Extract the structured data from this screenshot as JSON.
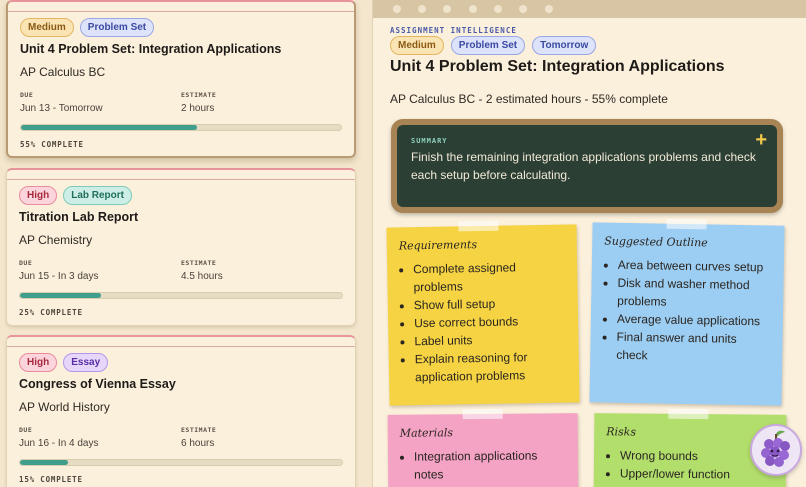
{
  "assignments": [
    {
      "priority": "Medium",
      "type": "Problem Set",
      "title": "Unit 4 Problem Set: Integration Applications",
      "course": "AP Calculus BC",
      "due_label": "DUE",
      "due": "Jun 13 - Tomorrow",
      "estimate_label": "ESTIMATE",
      "estimate": "2 hours",
      "progress": 55,
      "progress_text": "55% COMPLETE"
    },
    {
      "priority": "High",
      "type": "Lab Report",
      "title": "Titration Lab Report",
      "course": "AP Chemistry",
      "due_label": "DUE",
      "due": "Jun 15 - In 3 days",
      "estimate_label": "ESTIMATE",
      "estimate": "4.5 hours",
      "progress": 25,
      "progress_text": "25% COMPLETE"
    },
    {
      "priority": "High",
      "type": "Essay",
      "title": "Congress of Vienna Essay",
      "course": "AP World History",
      "due_label": "DUE",
      "due": "Jun 16 - In 4 days",
      "estimate_label": "ESTIMATE",
      "estimate": "6 hours",
      "progress": 15,
      "progress_text": "15% COMPLETE"
    }
  ],
  "detail": {
    "eyebrow": "ASSIGNMENT INTELLIGENCE",
    "badges": [
      "Medium",
      "Problem Set",
      "Tomorrow"
    ],
    "title": "Unit 4 Problem Set: Integration Applications",
    "subtitle": "AP Calculus BC - 2 estimated hours - 55% complete",
    "summary_label": "SUMMARY",
    "summary": "Finish the remaining integration applications problems and check each setup before calculating.",
    "summary_action": "+",
    "requirements": {
      "title": "Requirements",
      "items": [
        "Complete assigned problems",
        "Show full setup",
        "Use correct bounds",
        "Label units",
        "Explain reasoning for application problems"
      ]
    },
    "outline": {
      "title": "Suggested Outline",
      "items": [
        "Area between curves setup",
        "Disk and washer method problems",
        "Average value applications",
        "Final answer and units check"
      ]
    },
    "materials": {
      "title": "Materials",
      "items": [
        "Integration applications notes"
      ]
    },
    "risks": {
      "title": "Risks",
      "items": [
        "Wrong bounds",
        "Upper/lower function"
      ]
    }
  },
  "colors": {
    "accent_teal": "#3f9e8c",
    "summary_bg": "#2c3f34",
    "note_yellow": "#f5d343",
    "note_blue": "#9ccdf2",
    "note_pink": "#f4a3c5",
    "note_green": "#b2de6c"
  },
  "icons": {
    "mascot": "grape-icon",
    "summary_add": "plus-icon"
  }
}
